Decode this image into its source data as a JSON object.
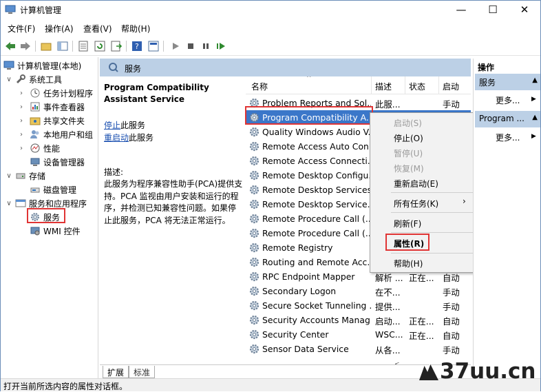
{
  "window": {
    "title": "计算机管理",
    "controls": {
      "minimize": "—",
      "maximize": "☐",
      "close": "✕"
    }
  },
  "menu": [
    "文件(F)",
    "操作(A)",
    "查看(V)",
    "帮助(H)"
  ],
  "tree": {
    "root": "计算机管理(本地)",
    "items": [
      {
        "label": "系统工具",
        "level": 1,
        "exp": "∨"
      },
      {
        "label": "任务计划程序",
        "level": 2,
        "exp": "›"
      },
      {
        "label": "事件查看器",
        "level": 2,
        "exp": "›"
      },
      {
        "label": "共享文件夹",
        "level": 2,
        "exp": "›"
      },
      {
        "label": "本地用户和组",
        "level": 2,
        "exp": "›"
      },
      {
        "label": "性能",
        "level": 2,
        "exp": "›"
      },
      {
        "label": "设备管理器",
        "level": 2,
        "exp": ""
      },
      {
        "label": "存储",
        "level": 1,
        "exp": "∨"
      },
      {
        "label": "磁盘管理",
        "level": 2,
        "exp": ""
      },
      {
        "label": "服务和应用程序",
        "level": 1,
        "exp": "∨"
      },
      {
        "label": "服务",
        "level": 2,
        "exp": ""
      },
      {
        "label": "WMI 控件",
        "level": 2,
        "exp": ""
      }
    ]
  },
  "center": {
    "header": "服务",
    "desc": {
      "title": "Program Compatibility Assistant Service",
      "stop_link": "停止",
      "stop_suffix": "此服务",
      "restart_link": "重启动",
      "restart_suffix": "此服务",
      "label": "描述:",
      "body": "此服务为程序兼容性助手(PCA)提供支持。PCA 监视由用户安装和运行的程序，并检测已知兼容性问题。如果停止此服务，PCA 将无法正常运行。"
    },
    "columns": {
      "name": "名称",
      "desc": "描述",
      "status": "状态",
      "startup": "启动"
    },
    "rows": [
      {
        "name": "Problem Reports and Sol...",
        "desc": "此服...",
        "status": "",
        "startup": "手动"
      },
      {
        "name": "Program Compatibility A...",
        "desc": "",
        "status": "",
        "startup": ""
      },
      {
        "name": "Quality Windows Audio V...",
        "desc": "",
        "status": "",
        "startup": ""
      },
      {
        "name": "Remote Access Auto Con...",
        "desc": "",
        "status": "",
        "startup": ""
      },
      {
        "name": "Remote Access Connecti...",
        "desc": "",
        "status": "",
        "startup": ""
      },
      {
        "name": "Remote Desktop Configu...",
        "desc": "",
        "status": "",
        "startup": ""
      },
      {
        "name": "Remote Desktop Services",
        "desc": "",
        "status": "",
        "startup": ""
      },
      {
        "name": "Remote Desktop Service...",
        "desc": "",
        "status": "",
        "startup": ""
      },
      {
        "name": "Remote Procedure Call (...",
        "desc": "",
        "status": "",
        "startup": ""
      },
      {
        "name": "Remote Procedure Call (...",
        "desc": "",
        "status": "",
        "startup": ""
      },
      {
        "name": "Remote Registry",
        "desc": "",
        "status": "",
        "startup": ""
      },
      {
        "name": "Routing and Remote Acc...",
        "desc": "",
        "status": "",
        "startup": ""
      },
      {
        "name": "RPC Endpoint Mapper",
        "desc": "解析 ...",
        "status": "正在...",
        "startup": "自动"
      },
      {
        "name": "Secondary Logon",
        "desc": "在不...",
        "status": "",
        "startup": "手动"
      },
      {
        "name": "Secure Socket Tunneling ...",
        "desc": "提供...",
        "status": "",
        "startup": "手动"
      },
      {
        "name": "Security Accounts Manag...",
        "desc": "启动...",
        "status": "正在...",
        "startup": "自动"
      },
      {
        "name": "Security Center",
        "desc": "WSC...",
        "status": "正在...",
        "startup": "自动"
      },
      {
        "name": "Sensor Data Service",
        "desc": "从各...",
        "status": "",
        "startup": "手动"
      }
    ],
    "tabs": [
      "扩展",
      "标准"
    ]
  },
  "context_menu": [
    {
      "label": "启动(S)",
      "disabled": true
    },
    {
      "label": "停止(O)",
      "disabled": false
    },
    {
      "label": "暂停(U)",
      "disabled": true
    },
    {
      "label": "恢复(M)",
      "disabled": true
    },
    {
      "label": "重新启动(E)",
      "disabled": false
    },
    {
      "label": "所有任务(K)",
      "disabled": false
    },
    {
      "label": "刷新(F)",
      "disabled": false
    },
    {
      "label": "属性(R)",
      "disabled": false
    },
    {
      "label": "帮助(H)",
      "disabled": false
    }
  ],
  "actions": {
    "header": "操作",
    "group1": "服务",
    "more1": "更多...",
    "group2": "Program ...",
    "more2": "更多..."
  },
  "status": "打开当前所选内容的属性对话框。",
  "watermark": "37uu.cn",
  "colors": {
    "selection": "#3b77c9",
    "highlight_box": "#e03434",
    "pane_header": "#bcd0e6"
  }
}
